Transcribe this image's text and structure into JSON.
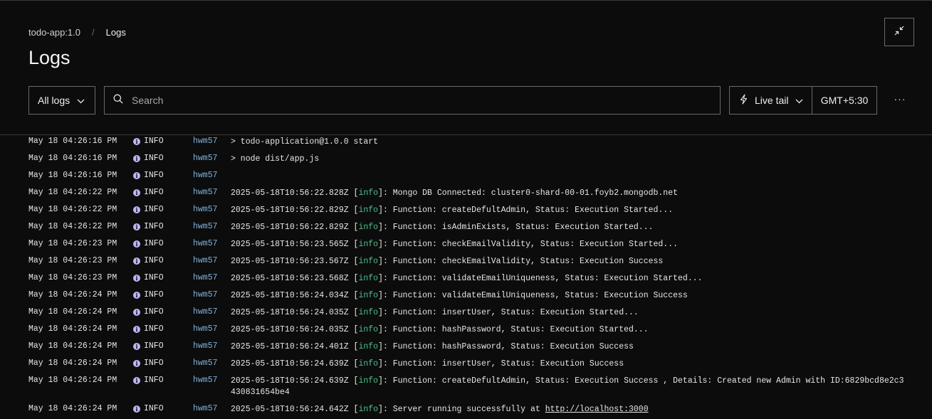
{
  "breadcrumb": {
    "app": "todo-app:1.0",
    "separator": "/",
    "current": "Logs"
  },
  "title": "Logs",
  "filter": {
    "label": "All logs"
  },
  "search": {
    "placeholder": "Search"
  },
  "live_tail": {
    "label": "Live tail"
  },
  "timezone": "GMT+5:30",
  "more": "···",
  "colors": {
    "background": "#0c0c0c",
    "info_icon": "#c4b5fd",
    "info_tag": "#4cc38a",
    "source": "#7fb0d8"
  },
  "logs": [
    {
      "ts": "May 18 04:26:16 PM",
      "level": "INFO",
      "source": "hwm57",
      "pre": "> todo-application@1.0.0 start",
      "tag": "",
      "post": ""
    },
    {
      "ts": "May 18 04:26:16 PM",
      "level": "INFO",
      "source": "hwm57",
      "pre": "> node dist/app.js",
      "tag": "",
      "post": ""
    },
    {
      "ts": "May 18 04:26:16 PM",
      "level": "INFO",
      "source": "hwm57",
      "pre": "",
      "tag": "",
      "post": ""
    },
    {
      "ts": "May 18 04:26:22 PM",
      "level": "INFO",
      "source": "hwm57",
      "pre": "2025-05-18T10:56:22.828Z [",
      "tag": "info",
      "post": "]: Mongo DB Connected: cluster0-shard-00-01.foyb2.mongodb.net"
    },
    {
      "ts": "May 18 04:26:22 PM",
      "level": "INFO",
      "source": "hwm57",
      "pre": "2025-05-18T10:56:22.829Z [",
      "tag": "info",
      "post": "]: Function: createDefultAdmin, Status: Execution Started..."
    },
    {
      "ts": "May 18 04:26:22 PM",
      "level": "INFO",
      "source": "hwm57",
      "pre": "2025-05-18T10:56:22.829Z [",
      "tag": "info",
      "post": "]: Function: isAdminExists, Status: Execution Started..."
    },
    {
      "ts": "May 18 04:26:23 PM",
      "level": "INFO",
      "source": "hwm57",
      "pre": "2025-05-18T10:56:23.565Z [",
      "tag": "info",
      "post": "]: Function: checkEmailValidity, Status: Execution Started..."
    },
    {
      "ts": "May 18 04:26:23 PM",
      "level": "INFO",
      "source": "hwm57",
      "pre": "2025-05-18T10:56:23.567Z [",
      "tag": "info",
      "post": "]: Function: checkEmailValidity, Status: Execution Success"
    },
    {
      "ts": "May 18 04:26:23 PM",
      "level": "INFO",
      "source": "hwm57",
      "pre": "2025-05-18T10:56:23.568Z [",
      "tag": "info",
      "post": "]: Function: validateEmailUniqueness, Status: Execution Started..."
    },
    {
      "ts": "May 18 04:26:24 PM",
      "level": "INFO",
      "source": "hwm57",
      "pre": "2025-05-18T10:56:24.034Z [",
      "tag": "info",
      "post": "]: Function: validateEmailUniqueness, Status: Execution Success"
    },
    {
      "ts": "May 18 04:26:24 PM",
      "level": "INFO",
      "source": "hwm57",
      "pre": "2025-05-18T10:56:24.035Z [",
      "tag": "info",
      "post": "]: Function: insertUser, Status: Execution Started..."
    },
    {
      "ts": "May 18 04:26:24 PM",
      "level": "INFO",
      "source": "hwm57",
      "pre": "2025-05-18T10:56:24.035Z [",
      "tag": "info",
      "post": "]: Function: hashPassword, Status: Execution Started..."
    },
    {
      "ts": "May 18 04:26:24 PM",
      "level": "INFO",
      "source": "hwm57",
      "pre": "2025-05-18T10:56:24.401Z [",
      "tag": "info",
      "post": "]: Function: hashPassword, Status: Execution Success"
    },
    {
      "ts": "May 18 04:26:24 PM",
      "level": "INFO",
      "source": "hwm57",
      "pre": "2025-05-18T10:56:24.639Z [",
      "tag": "info",
      "post": "]: Function: insertUser, Status: Execution Success"
    },
    {
      "ts": "May 18 04:26:24 PM",
      "level": "INFO",
      "source": "hwm57",
      "pre": "2025-05-18T10:56:24.639Z [",
      "tag": "info",
      "post": "]: Function: createDefultAdmin, Status: Execution Success , Details: Created new Admin with ID:6829bcd8e2c3430831654be4"
    },
    {
      "ts": "May 18 04:26:24 PM",
      "level": "INFO",
      "source": "hwm57",
      "pre": "2025-05-18T10:56:24.642Z [",
      "tag": "info",
      "post": "]: Server running successfully at ",
      "link": "http://localhost:3000"
    }
  ]
}
